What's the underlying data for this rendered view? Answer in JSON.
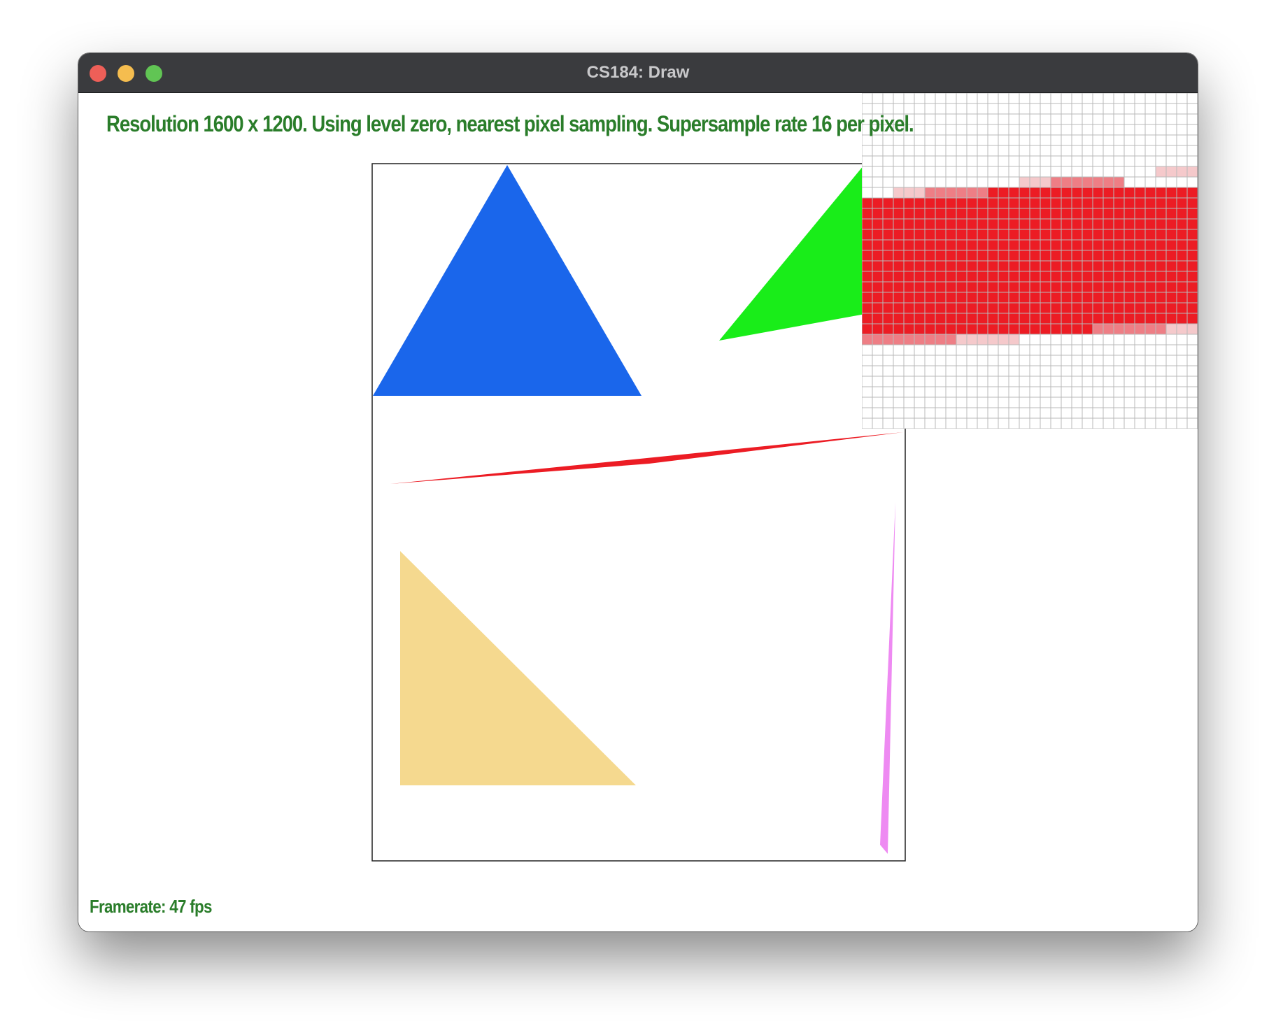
{
  "window": {
    "title": "CS184: Draw"
  },
  "status": {
    "info": "Resolution 1600 x 1200. Using level zero, nearest pixel sampling. Supersample rate 16 per pixel.",
    "framerate": "Framerate: 47 fps"
  },
  "colors": {
    "text_green": "#2a7d2a",
    "blue": "#1a66eb",
    "green": "#19ed19",
    "red": "#ec1c24",
    "tan": "#f5d98f",
    "pink": "#ee8af2",
    "grid": "#b9b9b9"
  },
  "icons": {
    "close": "close-dot-icon",
    "minimize": "minimize-dot-icon",
    "maximize": "maximize-dot-icon"
  }
}
